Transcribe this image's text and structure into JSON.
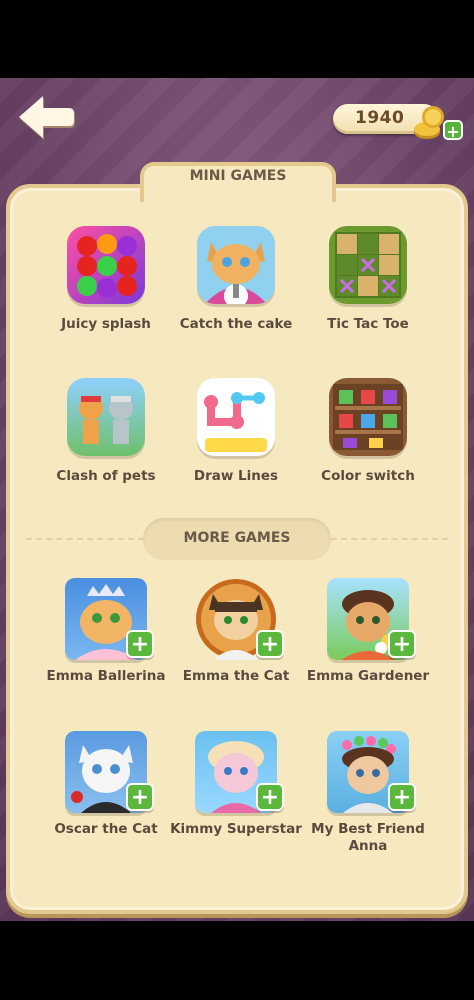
{
  "header": {
    "coins": "1940",
    "icons": {
      "back": "back-arrow-icon",
      "coin": "coin-stack-icon",
      "add": "plus-icon"
    }
  },
  "mini_games": {
    "title": "MINI GAMES",
    "items": [
      {
        "label": "Juicy splash",
        "icon": "fruit-icon"
      },
      {
        "label": "Catch the cake",
        "icon": "cat-cake-icon"
      },
      {
        "label": "Tic Tac Toe",
        "icon": "tic-tac-toe-icon"
      },
      {
        "label": "Clash of pets",
        "icon": "pets-icon"
      },
      {
        "label": "Draw Lines",
        "icon": "draw-lines-icon"
      },
      {
        "label": "Color switch",
        "icon": "gift-shelf-icon"
      }
    ]
  },
  "more_games": {
    "title": "MORE GAMES",
    "items": [
      {
        "label": "Emma  Ballerina",
        "icon": "emma-ballerina-icon"
      },
      {
        "label": "Emma the Cat",
        "icon": "emma-cat-icon"
      },
      {
        "label": "Emma Gardener",
        "icon": "emma-gardener-icon"
      },
      {
        "label": "Oscar the Cat",
        "icon": "oscar-cat-icon"
      },
      {
        "label": "Kimmy Superstar",
        "icon": "kimmy-icon"
      },
      {
        "label": "My Best Friend Anna",
        "icon": "anna-icon"
      }
    ]
  },
  "colors": {
    "panel": "#f7e9bf",
    "border": "#e3c98d",
    "background": "#6e4668",
    "plus": "#5bb83c"
  }
}
